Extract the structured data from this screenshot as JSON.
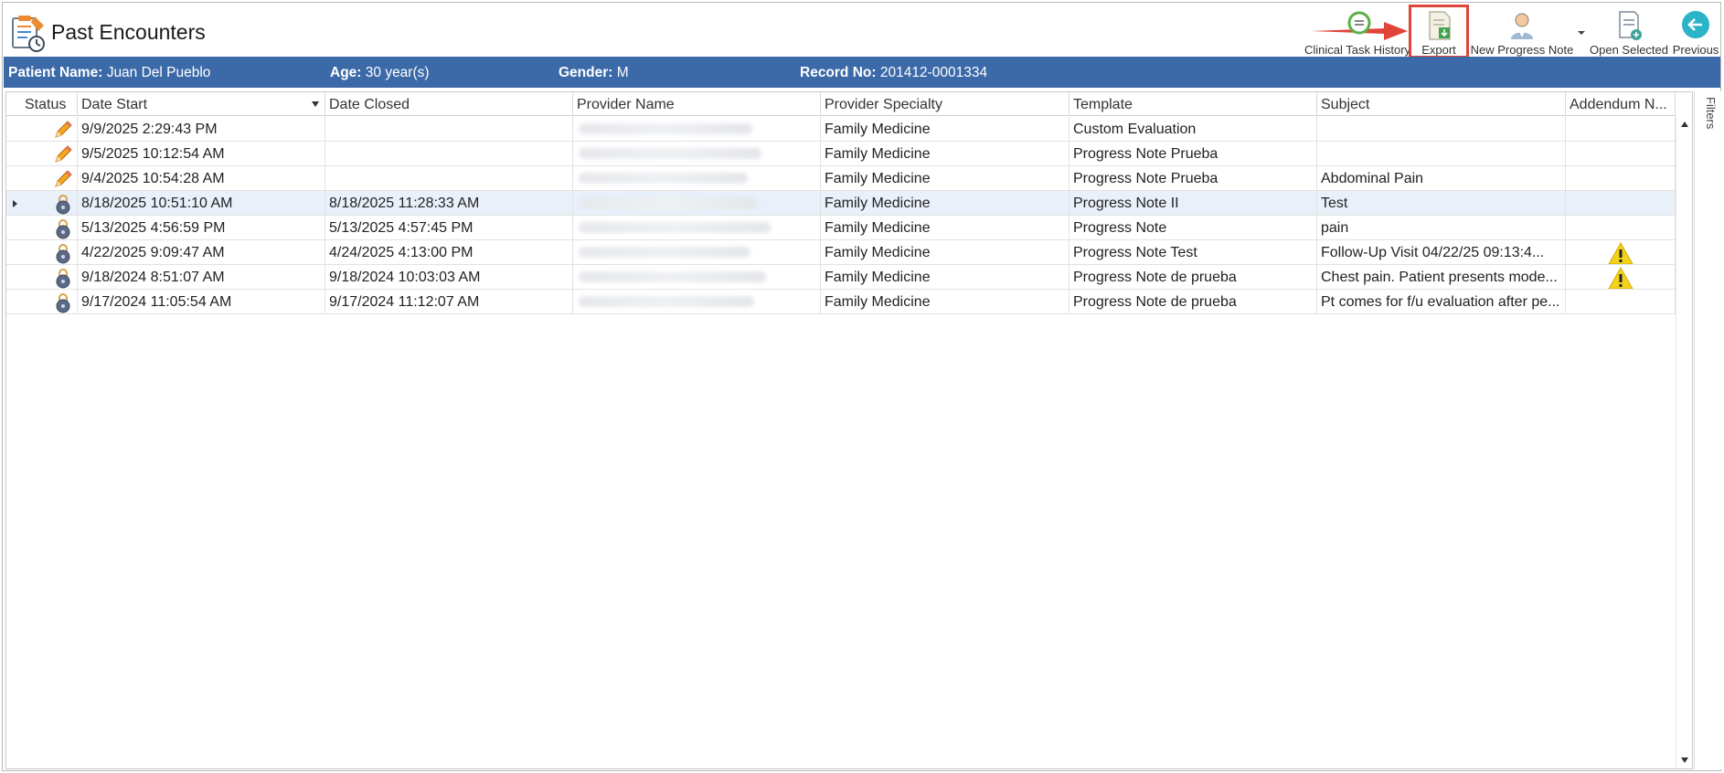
{
  "window": {
    "title": "Past Encounters"
  },
  "toolbar": {
    "clinical_task_history": "Clinical Task History",
    "export": "Export",
    "new_progress_note": "New Progress Note",
    "open_selected": "Open Selected",
    "previous": "Previous"
  },
  "patient": {
    "name_label": "Patient Name:",
    "name": "Juan Del Pueblo",
    "age_label": "Age:",
    "age": "30 year(s)",
    "gender_label": "Gender:",
    "gender": "M",
    "record_label": "Record No:",
    "record": "201412-0001334"
  },
  "grid": {
    "columns": [
      "Status",
      "Date Start",
      "Date Closed",
      "Provider Name",
      "Provider Specialty",
      "Template",
      "Subject",
      "Addendum N..."
    ],
    "rows": [
      {
        "status": "pencil-icon",
        "date_start": "9/9/2025 2:29:43 PM",
        "date_closed": "",
        "specialty": "Family Medicine",
        "template": "Custom Evaluation",
        "subject": "",
        "addendum": ""
      },
      {
        "status": "pencil-icon",
        "date_start": "9/5/2025 10:12:54 AM",
        "date_closed": "",
        "specialty": "Family Medicine",
        "template": "Progress Note Prueba",
        "subject": "",
        "addendum": ""
      },
      {
        "status": "pencil-icon",
        "date_start": "9/4/2025 10:54:28 AM",
        "date_closed": "",
        "specialty": "Family Medicine",
        "template": "Progress Note Prueba",
        "subject": "Abdominal Pain",
        "addendum": ""
      },
      {
        "status": "lock-icon",
        "date_start": "8/18/2025 10:51:10 AM",
        "date_closed": "8/18/2025 11:28:33 AM",
        "specialty": "Family Medicine",
        "template": "Progress Note II",
        "subject": "Test",
        "addendum": "",
        "selected": true
      },
      {
        "status": "lock-icon",
        "date_start": "5/13/2025 4:56:59 PM",
        "date_closed": "5/13/2025 4:57:45 PM",
        "specialty": "Family Medicine",
        "template": "Progress Note",
        "subject": "pain",
        "addendum": ""
      },
      {
        "status": "lock-icon",
        "date_start": "4/22/2025 9:09:47 AM",
        "date_closed": "4/24/2025 4:13:00 PM",
        "specialty": "Family Medicine",
        "template": "Progress Note Test",
        "subject": "  Follow-Up Visit   04/22/25 09:13:4...",
        "addendum": "warning-icon"
      },
      {
        "status": "lock-icon",
        "date_start": "9/18/2024 8:51:07 AM",
        "date_closed": "9/18/2024 10:03:03 AM",
        "specialty": "Family Medicine",
        "template": "Progress Note de prueba",
        "subject": "  Chest pain. Patient presents mode...",
        "addendum": "warning-icon"
      },
      {
        "status": "lock-icon",
        "date_start": "9/17/2024 11:05:54 AM",
        "date_closed": "9/17/2024 11:12:07 AM",
        "specialty": "Family Medicine",
        "template": "Progress Note de prueba",
        "subject": "Pt comes for f/u evaluation after pe...",
        "addendum": ""
      }
    ]
  },
  "filters": {
    "label": "Filters"
  },
  "colors": {
    "banner": "#3c6aa8",
    "highlight": "#e0453a",
    "selected_row": "#e9f0fa"
  }
}
